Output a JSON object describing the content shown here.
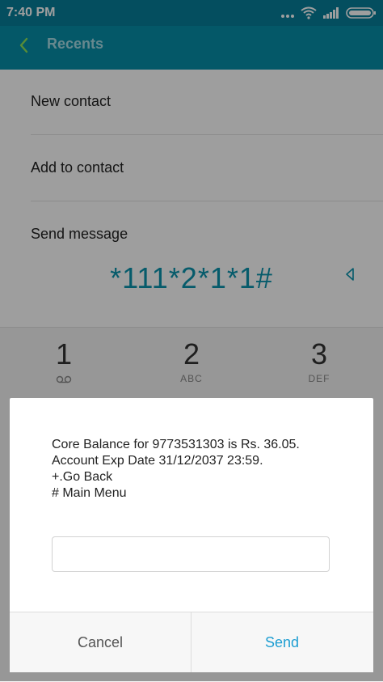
{
  "status": {
    "time": "7:40 PM"
  },
  "appbar": {
    "title": "Recents",
    "back_icon": "chevron-left-icon"
  },
  "menu": {
    "items": [
      {
        "label": "New contact"
      },
      {
        "label": "Add to contact"
      },
      {
        "label": "Send message"
      }
    ]
  },
  "dialer": {
    "number": "*111*2*1*1#",
    "keys": [
      {
        "digit": "1",
        "letters": ""
      },
      {
        "digit": "2",
        "letters": "ABC"
      },
      {
        "digit": "3",
        "letters": "DEF"
      }
    ]
  },
  "dialog": {
    "message_lines": [
      "Core Balance for 9773531303 is Rs. 36.05.",
      "Account Exp Date 31/12/2037 23:59.",
      "+.Go Back",
      "# Main Menu"
    ],
    "input_value": "",
    "cancel_label": "Cancel",
    "send_label": "Send"
  },
  "colors": {
    "statusbar": "#087f99",
    "appbar": "#088fa9",
    "accent": "#0b93ad",
    "send": "#1e9ed2"
  }
}
